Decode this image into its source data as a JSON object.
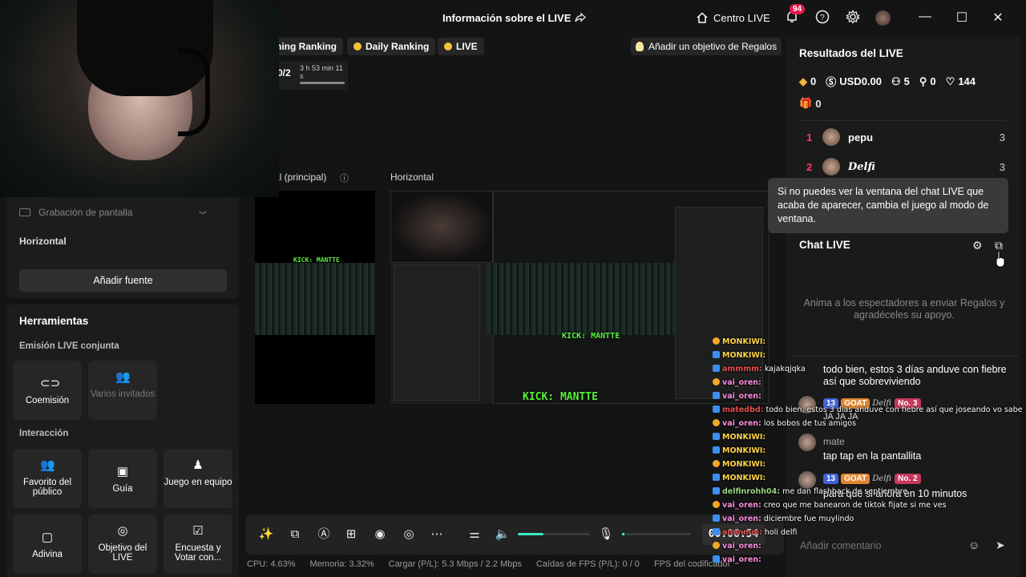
{
  "header": {
    "title": "Información sobre el LIVE",
    "centro_live": "Centro LIVE",
    "notif_count": "94"
  },
  "chips": {
    "partial_ranking": "ning Ranking",
    "daily_ranking": "Daily Ranking",
    "live": "LIVE",
    "goal": "Añadir un objetivo de Regalos"
  },
  "timer": {
    "fraction": "0/2",
    "time": "3 h 53 min 11 s"
  },
  "left": {
    "source_item": "Grabación de pantalla",
    "section": "Horizontal",
    "add_source": "Añadir fuente"
  },
  "tools": {
    "title": "Herramientas",
    "joint_live": "Emisión LIVE conjunta",
    "cohost": "Coemisión",
    "multi_guests": "Varios invitados",
    "interaction": "Interacción",
    "fav": "Favorito del público",
    "guide": "Guía",
    "team_game": "Juego en equipo",
    "guess": "Adivina",
    "live_goal": "Objetivo del LIVE",
    "poll": "Encuesta y Votar con..."
  },
  "preview": {
    "label_main": "al (principal)",
    "label_horizontal": "Horizontal",
    "kick_text": "KICK: MANTTE"
  },
  "controls": {
    "clock": "00:06:54",
    "volume_level": 0.35
  },
  "status": {
    "cpu": "CPU: 4.63%",
    "mem": "Memoria: 3.32%",
    "load": "Cargar (P/L): 5.3 Mbps / 2.2 Mbps",
    "fps_drop": "Caídas de FPS (P/L): 0 / 0",
    "encoder": "FPS del codificador"
  },
  "results": {
    "title": "Resultados del LIVE",
    "diamonds": "0",
    "usd": "USD0.00",
    "viewers": "5",
    "followers": "0",
    "likes": "144",
    "gifts": "0",
    "ranking": [
      {
        "pos": "1",
        "name": "pepu",
        "score": "3"
      },
      {
        "pos": "2",
        "name": "Delfi",
        "score": "3"
      }
    ]
  },
  "tooltip": "Si no puedes ver la ventana del chat LIVE que acaba de aparecer, cambia el juego al modo de ventana.",
  "chat": {
    "title": "Chat LIVE",
    "empty": "Anima a los espectadores a enviar Regalos y agradéceles su apoyo.",
    "msg1": "todo bien, estos 3 días anduve con fiebre así que sobreviviendo",
    "msg1_badges": {
      "level": "13",
      "goat": "GOAT",
      "user": "Delfi",
      "rank": "No. 3"
    },
    "msg1_tail": "JA JA JA",
    "msg2_user": "mate",
    "msg2": "tap tap en la pantallita",
    "msg3_badges": {
      "level": "13",
      "goat": "GOAT",
      "user": "Delfi",
      "rank": "No. 2"
    },
    "msg3": "para que si ahora en 10 minutos",
    "input_placeholder": "Añadir comentario"
  },
  "overlay_chat": [
    {
      "user": "MONKIWI:",
      "text": ""
    },
    {
      "user": "MONKIWI:",
      "text": ""
    },
    {
      "user": "ammmm:",
      "text": "kajakqjqka"
    },
    {
      "user": "vai_oren:",
      "text": ""
    },
    {
      "user": "vai_oren:",
      "text": ""
    },
    {
      "user": "matedbd:",
      "text": "todo bien, estos 3 días anduve con fiebre así que joseando vo sabe"
    },
    {
      "user": "vai_oren:",
      "text": "los bobos de tus amigos"
    },
    {
      "user": "MONKIWI:",
      "text": ""
    },
    {
      "user": "MONKIWI:",
      "text": ""
    },
    {
      "user": "MONKIWI:",
      "text": ""
    },
    {
      "user": "MONKIWI:",
      "text": ""
    },
    {
      "user": "delfinrohh04:",
      "text": "me dan flashback de septiembre"
    },
    {
      "user": "vai_oren:",
      "text": "creo que me banearon de tiktok fijate si me ves"
    },
    {
      "user": "vai_oren:",
      "text": "diciembre fue muylindo"
    },
    {
      "user": "ammmm:",
      "text": "holi delfi"
    },
    {
      "user": "vai_oren:",
      "text": ""
    },
    {
      "user": "vai_oren:",
      "text": ""
    }
  ]
}
